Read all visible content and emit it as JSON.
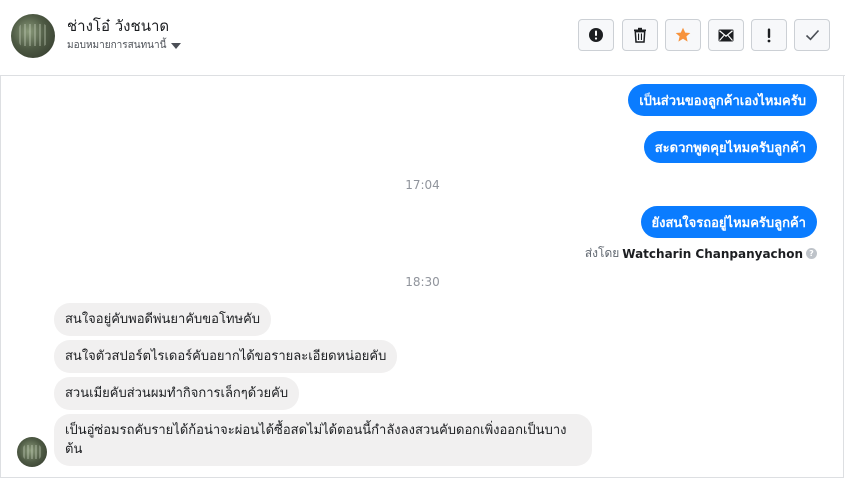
{
  "header": {
    "contact_name": "ช่างโอ๋ วังชนาด",
    "assign_label": "มอบหมายการสนทนานี้",
    "actions": [
      {
        "name": "mark-spam-button",
        "icon": "alert-circle-icon"
      },
      {
        "name": "delete-button",
        "icon": "trash-icon"
      },
      {
        "name": "star-button",
        "icon": "star-icon"
      },
      {
        "name": "mark-unread-button",
        "icon": "envelope-icon"
      },
      {
        "name": "follow-up-button",
        "icon": "exclamation-icon"
      },
      {
        "name": "mark-done-button",
        "icon": "checkmark-icon"
      }
    ]
  },
  "colors": {
    "outgoing_bubble": "#0a7cff",
    "incoming_bubble": "#f1f0f0",
    "star": "#f7923b"
  },
  "messages": {
    "out1": "เป็นส่วนของลูกค้าเองไหมครับ",
    "out2": "สะดวกพูดคุยไหมครับลูกค้า",
    "time1": "17:04",
    "out3": "ยังสนใจรถอยู่ไหมครับลูกค้า",
    "sent_by_prefix": "ส่งโดย",
    "sent_by_name": "Watcharin Chanpanyachon",
    "time2": "18:30",
    "in1": "สนใจอยู่คับพอดีพ่นยาคับขอโทษคับ",
    "in2": "สนใจตัวสปอร์ตไรเดอร์คับอยากได้ขอรายละเอียดหน่อยคับ",
    "in3": "สวนเมียคับส่วนผมทำกิจการเล็กๆด้วยคับ",
    "in4": "เป็นอู่ซ่อมรถคับรายได้ก้อน่าจะผ่อนได้ซื้อสดไม่ได้ตอนนี้กำลังลงสวนคับดอกเพิ่งออกเป็นบางต้น"
  }
}
